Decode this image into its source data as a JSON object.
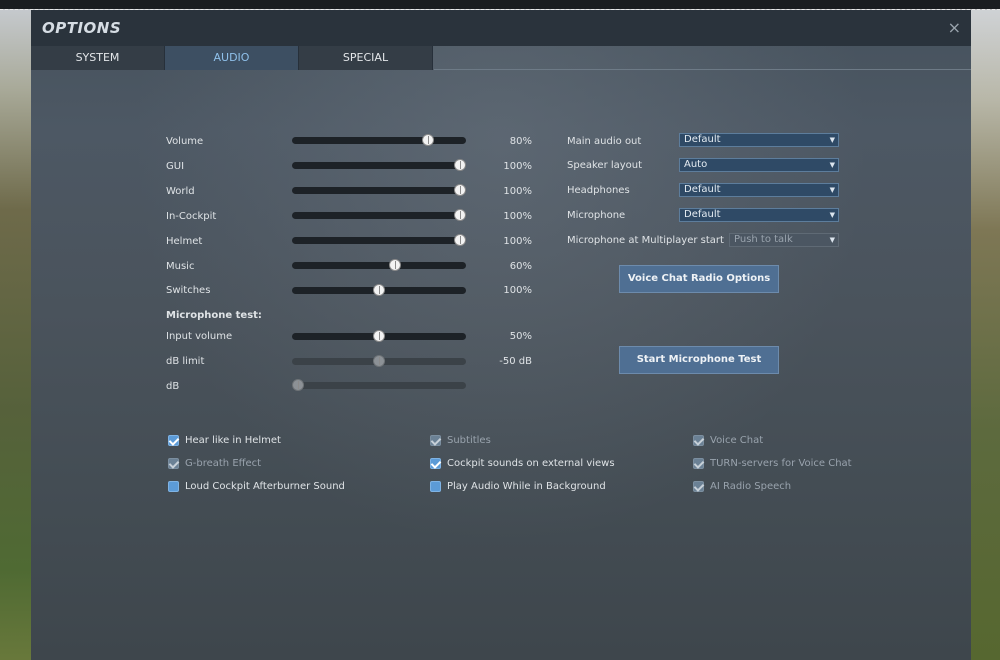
{
  "dialog": {
    "title": "OPTIONS",
    "close_icon": "×"
  },
  "tabs": [
    {
      "label": "SYSTEM",
      "active": false
    },
    {
      "label": "AUDIO",
      "active": true
    },
    {
      "label": "SPECIAL",
      "active": false
    }
  ],
  "volume_sliders": [
    {
      "label": "Volume",
      "value_text": "80%",
      "level": 0.8
    },
    {
      "label": "GUI",
      "value_text": "100%",
      "level": 1.0
    },
    {
      "label": "World",
      "value_text": "100%",
      "level": 1.0
    },
    {
      "label": "In-Cockpit",
      "value_text": "100%",
      "level": 1.0
    },
    {
      "label": "Helmet",
      "value_text": "100%",
      "level": 1.0
    },
    {
      "label": "Music",
      "value_text": "60%",
      "level": 0.6
    },
    {
      "label": "Switches",
      "value_text": "100%",
      "level": 0.5
    }
  ],
  "mic_test": {
    "heading": "Microphone test:",
    "input_volume": {
      "label": "Input volume",
      "value_text": "50%",
      "level": 0.5
    },
    "db_limit": {
      "label": "dB limit",
      "value_text": "-50 dB",
      "level": 0.5
    },
    "db": {
      "label": "dB",
      "level": 0.0
    }
  },
  "devices": {
    "main_audio_out": {
      "label": "Main audio out",
      "value": "Default"
    },
    "speaker_layout": {
      "label": "Speaker layout",
      "value": "Auto"
    },
    "headphones": {
      "label": "Headphones",
      "value": "Default"
    },
    "microphone": {
      "label": "Microphone",
      "value": "Default"
    },
    "mic_mp_start": {
      "label": "Microphone at Multiplayer start",
      "value": "Push to talk"
    }
  },
  "buttons": {
    "voice_chat_radio": "Voice Chat Radio Options",
    "start_mic_test": "Start Microphone Test"
  },
  "checkboxes": {
    "hear_like_helmet": {
      "label": "Hear like in Helmet",
      "state": "checked"
    },
    "g_breath": {
      "label": "G-breath Effect",
      "state": "disabled-checked"
    },
    "loud_afterburner": {
      "label": "Loud Cockpit Afterburner Sound",
      "state": "unchecked"
    },
    "subtitles": {
      "label": "Subtitles",
      "state": "disabled-checked"
    },
    "cockpit_external": {
      "label": "Cockpit sounds on external views",
      "state": "checked"
    },
    "play_background": {
      "label": "Play Audio While in Background",
      "state": "unchecked"
    },
    "voice_chat": {
      "label": "Voice Chat",
      "state": "disabled-checked"
    },
    "turn_servers": {
      "label": "TURN-servers for Voice Chat",
      "state": "disabled-checked"
    },
    "ai_radio_speech": {
      "label": "AI Radio Speech",
      "state": "disabled-checked"
    }
  },
  "icons": {
    "dropdown": "chevron-down-icon",
    "close": "close-icon",
    "checkbox": "check-icon"
  }
}
